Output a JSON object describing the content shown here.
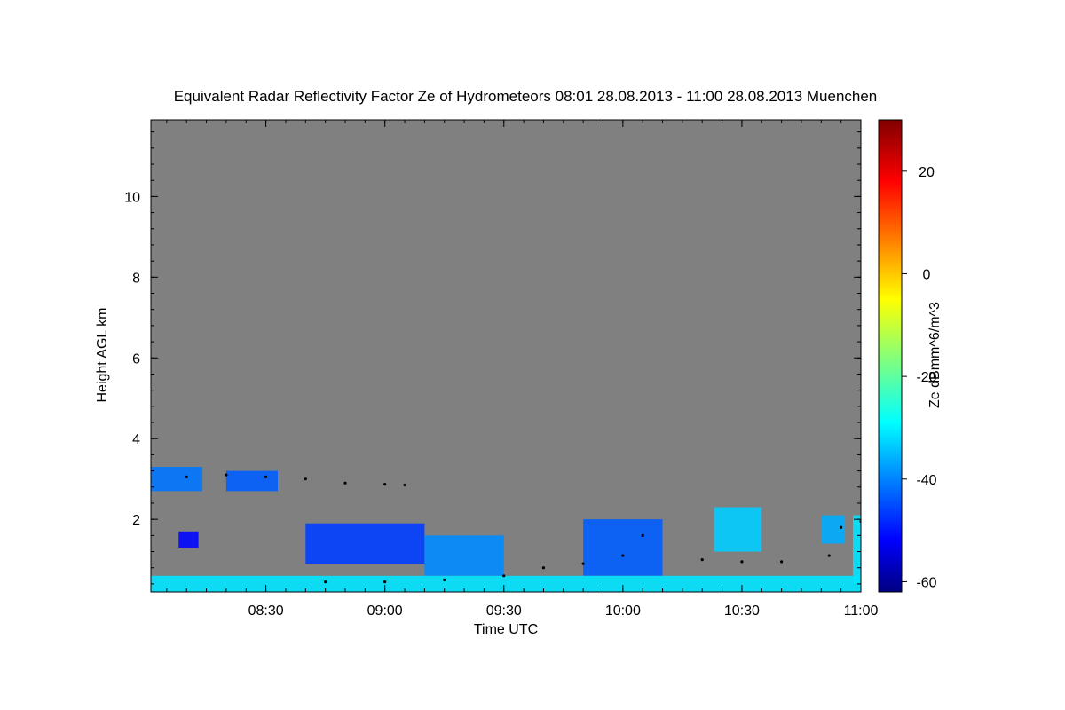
{
  "chart_data": {
    "type": "heatmap",
    "title": "Equivalent Radar Reflectivity Factor Ze of Hydrometeors   08:01 28.08.2013 - 11:00 28.08.2013 Muenchen",
    "xlabel": "Time UTC",
    "ylabel": "Height AGL km",
    "x_range": [
      "08:01",
      "11:00"
    ],
    "ylim": [
      0.2,
      11.9
    ],
    "x_ticks": [
      "08:30",
      "09:00",
      "09:30",
      "10:00",
      "10:30",
      "11:00"
    ],
    "y_ticks": [
      "2",
      "4",
      "6",
      "8",
      "10"
    ],
    "colorbar": {
      "label": "Ze dBmm^6/m^3",
      "range": [
        -62,
        30
      ],
      "ticks": [
        "-60",
        "-40",
        "-20",
        "0",
        "20"
      ],
      "colormap": "jet"
    },
    "background_color": "#808080",
    "echoes": [
      {
        "t0": "08:01",
        "t1": "08:14",
        "h0": 2.7,
        "h1": 3.3,
        "ze": -40
      },
      {
        "t0": "08:20",
        "t1": "08:33",
        "h0": 2.7,
        "h1": 3.2,
        "ze": -42
      },
      {
        "t0": "08:08",
        "t1": "08:13",
        "h0": 1.3,
        "h1": 1.7,
        "ze": -50
      },
      {
        "t0": "08:40",
        "t1": "09:10",
        "h0": 0.9,
        "h1": 1.9,
        "ze": -45
      },
      {
        "t0": "09:10",
        "t1": "09:30",
        "h0": 0.6,
        "h1": 1.6,
        "ze": -38
      },
      {
        "t0": "09:50",
        "t1": "10:10",
        "h0": 0.6,
        "h1": 2.0,
        "ze": -42
      },
      {
        "t0": "10:23",
        "t1": "10:35",
        "h0": 1.2,
        "h1": 2.3,
        "ze": -32
      },
      {
        "t0": "10:50",
        "t1": "10:56",
        "h0": 1.4,
        "h1": 2.1,
        "ze": -35
      },
      {
        "t0": "10:58",
        "t1": "11:00",
        "h0": 0.4,
        "h1": 2.1,
        "ze": -30
      },
      {
        "t0": "08:01",
        "t1": "11:00",
        "h0": 0.2,
        "h1": 0.6,
        "ze": -30
      }
    ],
    "cloud_base_dots": [
      {
        "t": "08:10",
        "h": 3.05
      },
      {
        "t": "08:20",
        "h": 3.1
      },
      {
        "t": "08:30",
        "h": 3.05
      },
      {
        "t": "08:40",
        "h": 3.0
      },
      {
        "t": "08:50",
        "h": 2.9
      },
      {
        "t": "09:00",
        "h": 2.87
      },
      {
        "t": "09:05",
        "h": 2.85
      },
      {
        "t": "08:45",
        "h": 0.45
      },
      {
        "t": "09:00",
        "h": 0.45
      },
      {
        "t": "09:15",
        "h": 0.5
      },
      {
        "t": "09:30",
        "h": 0.6
      },
      {
        "t": "09:40",
        "h": 0.8
      },
      {
        "t": "09:50",
        "h": 0.9
      },
      {
        "t": "10:00",
        "h": 1.1
      },
      {
        "t": "10:05",
        "h": 1.6
      },
      {
        "t": "10:20",
        "h": 1.0
      },
      {
        "t": "10:30",
        "h": 0.95
      },
      {
        "t": "10:40",
        "h": 0.95
      },
      {
        "t": "10:52",
        "h": 1.1
      },
      {
        "t": "10:55",
        "h": 1.8
      },
      {
        "t": "11:00",
        "h": 1.95
      }
    ]
  }
}
